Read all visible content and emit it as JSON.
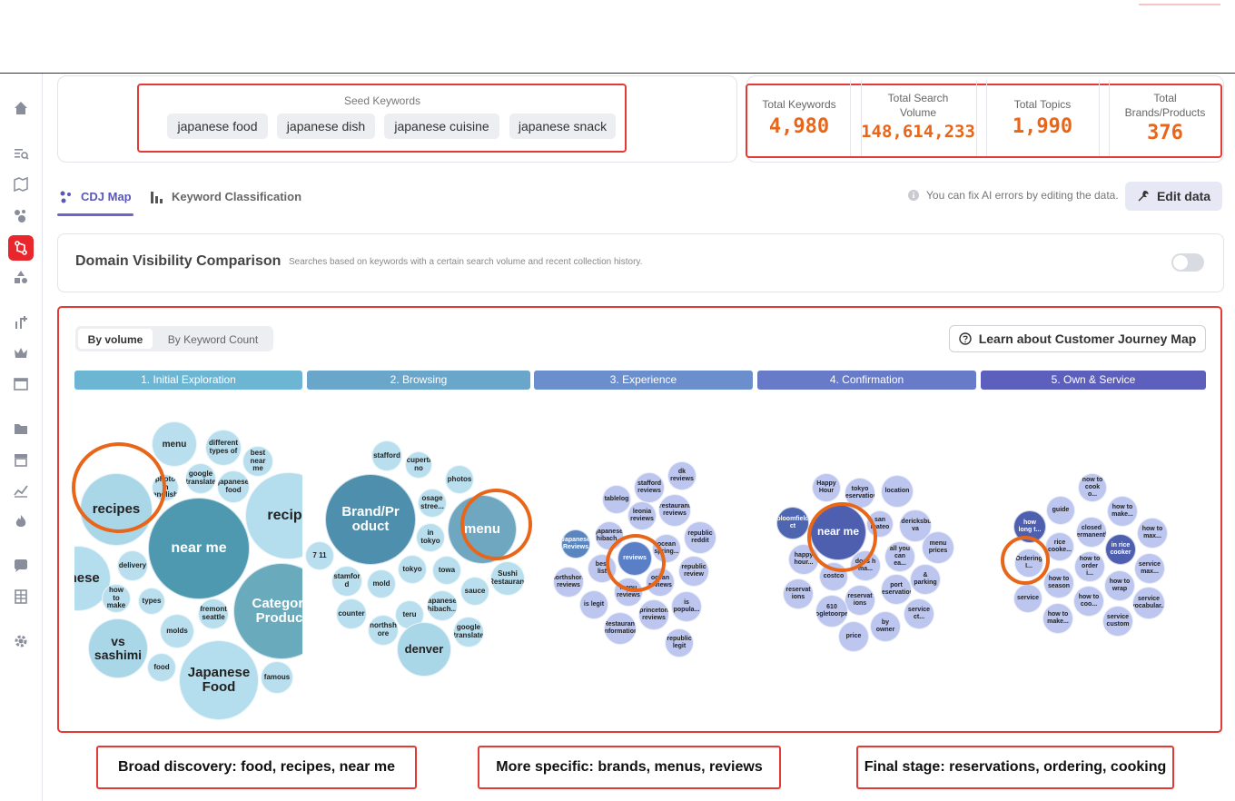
{
  "seed": {
    "title": "Seed Keywords",
    "chips": [
      "japanese food",
      "japanese dish",
      "japanese cuisine",
      "japanese snack"
    ]
  },
  "stats": [
    {
      "label": "Total Keywords",
      "value": "4,980"
    },
    {
      "label": "Total Search Volume",
      "value": "148,614,233"
    },
    {
      "label": "Total Topics",
      "value": "1,990"
    },
    {
      "label": "Total Brands/Products",
      "value": "376"
    }
  ],
  "tabs": {
    "cdj": "CDJ Map",
    "classification": "Keyword Classification"
  },
  "hint": "You can fix AI errors by editing the data.",
  "edit_button": "Edit data",
  "dvc": {
    "title": "Domain Visibility Comparison",
    "subtitle": "Searches based on keywords with a certain search volume and recent collection history."
  },
  "segment": {
    "by_volume": "By volume",
    "by_count": "By Keyword Count"
  },
  "learn_button": "Learn about Customer Journey Map",
  "stages": [
    {
      "label": "1. Initial Exploration",
      "color": "#6cb6d3"
    },
    {
      "label": "2. Browsing",
      "color": "#6aa6c9"
    },
    {
      "label": "3. Experience",
      "color": "#6b8fcc"
    },
    {
      "label": "4. Confirmation",
      "color": "#687bc9"
    },
    {
      "label": "5. Own & Service",
      "color": "#5d5fbd"
    }
  ],
  "clusters": [
    [
      {
        "t": "menu"
      },
      {
        "t": "different types of"
      },
      {
        "t": "best near me"
      },
      {
        "t": "google translate"
      },
      {
        "t": "japanese food"
      },
      {
        "t": "photo in english"
      },
      {
        "t": "recipes"
      },
      {
        "t": "near me"
      },
      {
        "t": "recipe"
      },
      {
        "t": "n nese"
      },
      {
        "t": "delivery"
      },
      {
        "t": "how to make"
      },
      {
        "t": "types"
      },
      {
        "t": "fremont seattle"
      },
      {
        "t": "Category Product"
      },
      {
        "t": "molds"
      },
      {
        "t": "vs sashimi"
      },
      {
        "t": "food"
      },
      {
        "t": "Japanese Food"
      },
      {
        "t": "famous"
      }
    ],
    [
      {
        "t": "stafford"
      },
      {
        "t": "cuperti no"
      },
      {
        "t": "photos"
      },
      {
        "t": "osage stree..."
      },
      {
        "t": "Brand/Pr oduct"
      },
      {
        "t": "in tokyo"
      },
      {
        "t": "menu"
      },
      {
        "t": "7 11"
      },
      {
        "t": "tokyo"
      },
      {
        "t": "towa"
      },
      {
        "t": "Sushi Restaurant"
      },
      {
        "t": "stamfor d"
      },
      {
        "t": "mold"
      },
      {
        "t": "sauce"
      },
      {
        "t": "teru"
      },
      {
        "t": "japanese, hibach..."
      },
      {
        "t": "counter"
      },
      {
        "t": "northsh ore"
      },
      {
        "t": "google translate"
      },
      {
        "t": "denver"
      }
    ],
    [
      {
        "t": "dk reviews"
      },
      {
        "t": "stafford reviews"
      },
      {
        "t": "tablelog"
      },
      {
        "t": "restaurant reviews"
      },
      {
        "t": "leonia reviews"
      },
      {
        "t": "japanese hibach..."
      },
      {
        "t": "republic reddit"
      },
      {
        "t": "Japanese Reviews"
      },
      {
        "t": "ocean spring..."
      },
      {
        "t": "reviews"
      },
      {
        "t": "best list"
      },
      {
        "t": "republic review"
      },
      {
        "t": "northshore reviews"
      },
      {
        "t": "ocean reviews"
      },
      {
        "t": "menu reviews"
      },
      {
        "t": "is legit"
      },
      {
        "t": "is popula..."
      },
      {
        "t": "princeton reviews"
      },
      {
        "t": "Restaurant Information"
      },
      {
        "t": "republic legit"
      }
    ],
    [
      {
        "t": "Happy Hour"
      },
      {
        "t": "tokyo reservation"
      },
      {
        "t": "location"
      },
      {
        "t": "bloomfield ct"
      },
      {
        "t": "near me"
      },
      {
        "t": "san mateo"
      },
      {
        "t": "fredericksburg va"
      },
      {
        "t": "all you can ea..."
      },
      {
        "t": "menu prices"
      },
      {
        "t": "happy hour..."
      },
      {
        "t": "does h ma..."
      },
      {
        "t": "costco"
      },
      {
        "t": "& parking"
      },
      {
        "t": "port reservation"
      },
      {
        "t": "reservat ions"
      },
      {
        "t": "reservat ions"
      },
      {
        "t": "service ct..."
      },
      {
        "t": "610 ogletoorpe"
      },
      {
        "t": "by owner"
      },
      {
        "t": "price"
      }
    ],
    [
      {
        "t": "how to cook o..."
      },
      {
        "t": "guide"
      },
      {
        "t": "how to make..."
      },
      {
        "t": "how long t..."
      },
      {
        "t": "closed permanently"
      },
      {
        "t": "how to max..."
      },
      {
        "t": "rice cooke..."
      },
      {
        "t": "in rice cooker"
      },
      {
        "t": "Ordering I..."
      },
      {
        "t": "how to order i..."
      },
      {
        "t": "service max..."
      },
      {
        "t": "how to season"
      },
      {
        "t": "how to wrap"
      },
      {
        "t": "service"
      },
      {
        "t": "how to coo..."
      },
      {
        "t": "service vocabular..."
      },
      {
        "t": "how to make..."
      },
      {
        "t": "service custom"
      }
    ]
  ],
  "callouts": [
    "Broad discovery: food, recipes, near me",
    "More specific: brands, menus, reviews",
    "Final stage: reservations, ordering, cooking"
  ]
}
